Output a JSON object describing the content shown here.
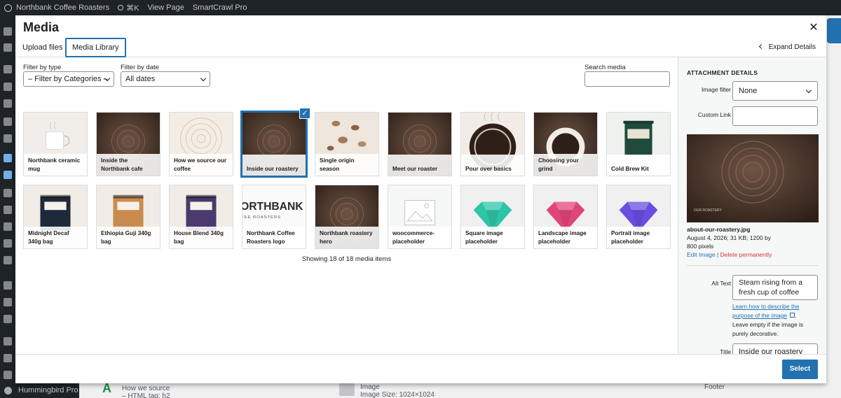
{
  "adminbar": {
    "site_name": "Northbank Coffee Roasters",
    "shortcut": "⌘K",
    "view_page": "View Page",
    "plugin": "SmartCrawl Pro"
  },
  "background": {
    "footer_menu": "Hummingbird Pro",
    "block1_title": "How we source",
    "block1_meta": "– HTML tag: h2",
    "block2_title": "Image",
    "block2_meta": "Image Size: 1024×1024",
    "block3": "Footer"
  },
  "modal": {
    "title": "Media",
    "close_icon": "close-icon",
    "expand_label": "Expand Details",
    "tabs": [
      {
        "label": "Upload files",
        "active": false
      },
      {
        "label": "Media Library",
        "active": true
      }
    ],
    "filters": {
      "type_label": "Filter by type",
      "type_value": "– Filter by Categories –",
      "date_label": "Filter by date",
      "date_value": "All dates",
      "search_label": "Search media",
      "search_value": ""
    },
    "items": [
      {
        "caption": "Northbank ceramic mug",
        "kind": "mug",
        "selected": false
      },
      {
        "caption": "Inside the Northbank cafe",
        "kind": "dark",
        "selected": false
      },
      {
        "caption": "How we source our coffee",
        "kind": "rings",
        "selected": false
      },
      {
        "caption": "Inside our roastery",
        "kind": "dark",
        "selected": true
      },
      {
        "caption": "Single origin season",
        "kind": "beans",
        "selected": false
      },
      {
        "caption": "Meet our roaster",
        "kind": "dark",
        "selected": false
      },
      {
        "caption": "Pour over basics",
        "kind": "cup",
        "selected": false
      },
      {
        "caption": "Choosing your grind",
        "kind": "cup2",
        "selected": false
      },
      {
        "caption": "Cold Brew Kit",
        "kind": "tin",
        "selected": false
      },
      {
        "caption": "Midnight Decaf 340g bag",
        "kind": "bag",
        "color": "#1e2a3a",
        "selected": false
      },
      {
        "caption": "Ethiopia Guji 340g bag",
        "kind": "bag",
        "color": "#c98b4e",
        "selected": false
      },
      {
        "caption": "House Blend 340g bag",
        "kind": "bag",
        "color": "#4a3a6e",
        "selected": false
      },
      {
        "caption": "Northbank Coffee Roasters logo",
        "kind": "logo",
        "logo_text": "ORTHBANK",
        "logo_sub": "FEE ROASTERS",
        "selected": false
      },
      {
        "caption": "Northbank roastery hero",
        "kind": "dark",
        "selected": false
      },
      {
        "caption": "woocommerce-placeholder",
        "kind": "placeholder",
        "selected": false
      },
      {
        "caption": "Square image placeholder",
        "kind": "gem",
        "color": "#2ec4a6",
        "selected": false
      },
      {
        "caption": "Landscape image placeholder",
        "kind": "gem",
        "color": "#e0457a",
        "selected": false
      },
      {
        "caption": "Portrait image placeholder",
        "kind": "gem",
        "color": "#6a4ee0",
        "selected": false
      }
    ],
    "showing_text": "Showing 18 of 18 media items",
    "details": {
      "heading": "Attachment Details",
      "image_filter_label": "Image filter",
      "image_filter_value": "None",
      "custom_link_label": "Custom Link",
      "custom_link_value": "",
      "preview_caption": "OUR ROASTERY",
      "filename": "about-our-roastery.jpg",
      "meta": "August 4, 2026;  31 KB;  1200 by 800 pixels",
      "edit_link": "Edit Image",
      "separator": "|",
      "delete_link": "Delete permanently",
      "alt_label": "Alt Text",
      "alt_value": "Steam rising from a fresh cup of coffee",
      "help_link": "Learn how to describe the purpose of the image",
      "help_after": ".",
      "help_note": "Leave empty if the image is purely decorative.",
      "title_label": "Title",
      "title_value": "Inside our roastery"
    },
    "select_button": "Select"
  }
}
